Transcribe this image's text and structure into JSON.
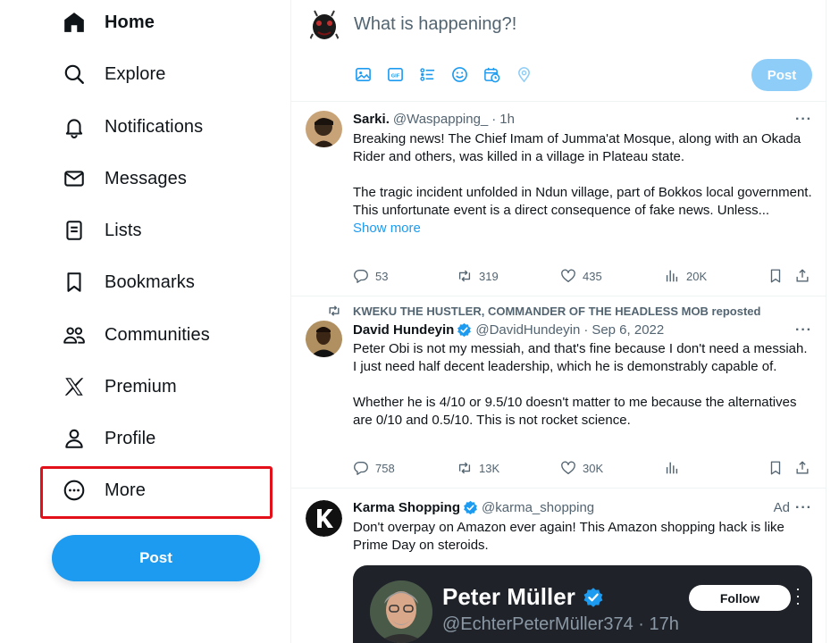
{
  "sidebar": {
    "items": [
      {
        "label": "Home",
        "icon": "home-icon"
      },
      {
        "label": "Explore",
        "icon": "search-icon"
      },
      {
        "label": "Notifications",
        "icon": "bell-icon"
      },
      {
        "label": "Messages",
        "icon": "envelope-icon"
      },
      {
        "label": "Lists",
        "icon": "list-icon"
      },
      {
        "label": "Bookmarks",
        "icon": "bookmark-icon"
      },
      {
        "label": "Communities",
        "icon": "communities-icon"
      },
      {
        "label": "Premium",
        "icon": "x-logo-icon"
      },
      {
        "label": "Profile",
        "icon": "person-icon"
      },
      {
        "label": "More",
        "icon": "more-circle-icon"
      }
    ],
    "post_label": "Post"
  },
  "composer": {
    "placeholder": "What is happening?!",
    "post_label": "Post",
    "tools": [
      "image-icon",
      "gif-icon",
      "poll-icon",
      "emoji-icon",
      "schedule-icon",
      "location-icon"
    ]
  },
  "tweets": [
    {
      "name": "Sarki.",
      "handle": "@Waspapping_",
      "time": "1h",
      "text1": "Breaking news! The Chief Imam of Jumma'at Mosque, along with an Okada Rider and others, was killed in a village in Plateau state.",
      "text2": "The tragic incident unfolded in Ndun village, part of Bokkos local government. This unfortunate event is a direct consequence of fake news. Unless...",
      "show_more": "Show more",
      "replies": "53",
      "reposts": "319",
      "likes": "435",
      "views": "20K"
    },
    {
      "repost_by": "KWEKU THE HUSTLER, COMMANDER OF THE HEADLESS MOB reposted",
      "name": "David Hundeyin",
      "handle": "@DavidHundeyin",
      "time": "Sep 6, 2022",
      "text1": "Peter Obi is not my messiah, and that's fine because I don't need a messiah. I just need half decent leadership, which he is demonstrably capable of.",
      "text2": "Whether he is 4/10 or 9.5/10 doesn't matter to me because the alternatives are 0/10 and 0.5/10. This is not rocket science.",
      "replies": "758",
      "reposts": "13K",
      "likes": "30K"
    },
    {
      "name": "Karma Shopping",
      "handle": "@karma_shopping",
      "ad_label": "Ad",
      "text1": "Don't overpay on Amazon ever again! This Amazon shopping hack is like Prime Day on steroids.",
      "card": {
        "name": "Peter Müller",
        "handle": "@EchterPeterMüller374 · 17h",
        "follow_label": "Follow"
      }
    }
  ],
  "colors": {
    "accent": "#1d9bf0",
    "accent_disabled": "#8ecdf8",
    "secondary_text": "#536471",
    "highlight": "#e3101a"
  }
}
